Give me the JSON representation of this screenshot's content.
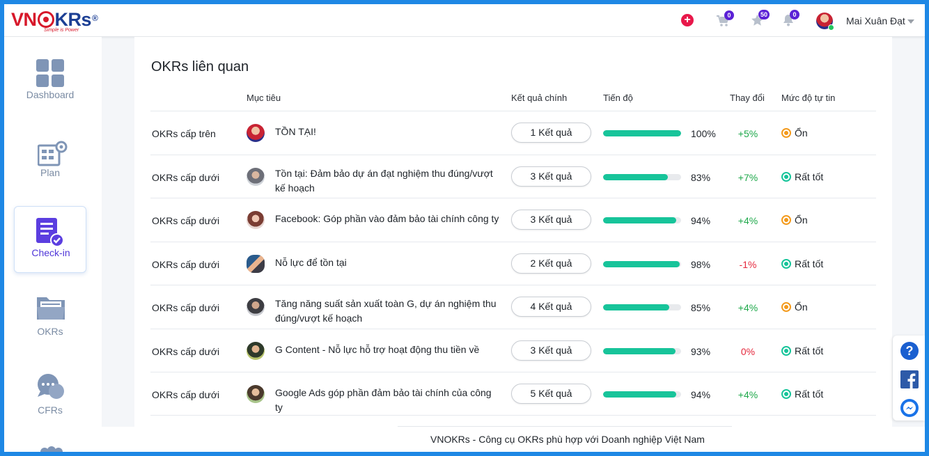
{
  "header": {
    "logo_text_vn": "VN",
    "logo_text_krs": "KRs",
    "logo_tagline": "Simple is Power",
    "cart_badge": "0",
    "star_badge": "50",
    "bell_badge": "0",
    "user_name": "Mai Xuân Đạt"
  },
  "sidebar": {
    "items": [
      {
        "label": "Dashboard"
      },
      {
        "label": "Plan"
      },
      {
        "label": "Check-in"
      },
      {
        "label": "OKRs"
      },
      {
        "label": "CFRs"
      }
    ]
  },
  "main": {
    "title": "OKRs liên quan",
    "columns": {
      "objective": "Mục tiêu",
      "key_results": "Kết quả chính",
      "progress": "Tiến độ",
      "change": "Thay đổi",
      "confidence": "Mức độ tự tin"
    },
    "rows": [
      {
        "level": "OKRs cấp trên",
        "objective": "TỒN TẠI!",
        "kr": "1 Kết quả",
        "progress": 100,
        "pct": "100%",
        "delta": "+5%",
        "delta_sign": "pos",
        "conf": "Ổn",
        "conf_color": "#f39a1c"
      },
      {
        "level": "OKRs cấp dưới",
        "objective": "Tồn tại: Đảm bảo dự án đạt nghiệm thu đúng/vượt kế hoạch",
        "kr": "3 Kết quả",
        "progress": 83,
        "pct": "83%",
        "delta": "+7%",
        "delta_sign": "pos",
        "conf": "Rất tốt",
        "conf_color": "#17c49a"
      },
      {
        "level": "OKRs cấp dưới",
        "objective": "Facebook: Góp phần vào đảm bảo tài chính công ty",
        "kr": "3 Kết quả",
        "progress": 94,
        "pct": "94%",
        "delta": "+4%",
        "delta_sign": "pos",
        "conf": "Ổn",
        "conf_color": "#f39a1c"
      },
      {
        "level": "OKRs cấp dưới",
        "objective": "Nỗ lực để tồn tại",
        "kr": "2 Kết quả",
        "progress": 98,
        "pct": "98%",
        "delta": "-1%",
        "delta_sign": "neg",
        "conf": "Rất tốt",
        "conf_color": "#17c49a"
      },
      {
        "level": "OKRs cấp dưới",
        "objective": "Tăng năng suất sản xuất toàn G, dự án nghiệm thu đúng/vượt kế hoạch",
        "kr": "4 Kết quả",
        "progress": 85,
        "pct": "85%",
        "delta": "+4%",
        "delta_sign": "pos",
        "conf": "Ổn",
        "conf_color": "#f39a1c"
      },
      {
        "level": "OKRs cấp dưới",
        "objective": "G Content - Nỗ lực hỗ trợ hoạt động thu tiền về",
        "kr": "3 Kết quả",
        "progress": 93,
        "pct": "93%",
        "delta": "0%",
        "delta_sign": "neg",
        "conf": "Rất tốt",
        "conf_color": "#17c49a"
      },
      {
        "level": "OKRs cấp dưới",
        "objective": "Google Ads góp phần đảm bảo tài chính của công ty",
        "kr": "5 Kết quả",
        "progress": 94,
        "pct": "94%",
        "delta": "+4%",
        "delta_sign": "pos",
        "conf": "Rất tốt",
        "conf_color": "#17c49a"
      }
    ]
  },
  "footer": {
    "text": "VNOKRs - Công cụ OKRs phù hợp với Doanh nghiệp Việt Nam"
  },
  "colors": {
    "brand_red": "#d7182a",
    "brand_blue": "#1c3f94",
    "accent_purple": "#4f36d8",
    "progress": "#17c49a",
    "frame_blue": "#1e88e5"
  }
}
